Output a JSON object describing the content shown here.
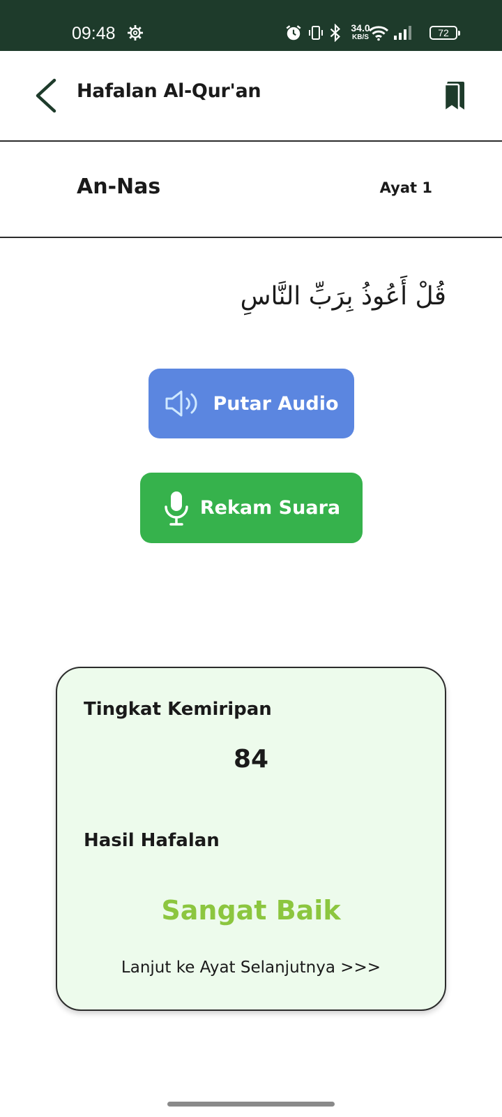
{
  "status_bar": {
    "time": "09:48",
    "net_speed_value": "34.0",
    "net_speed_unit": "KB/S",
    "battery_level": "72"
  },
  "app_bar": {
    "title": "Hafalan Al-Qur'an"
  },
  "surah": {
    "name": "An-Nas",
    "ayat_label": "Ayat 1"
  },
  "verse": {
    "arabic_text": "قُلْ أَعُوذُ بِرَبِّ النَّاسِ"
  },
  "actions": {
    "play_audio_label": "Putar Audio",
    "record_voice_label": "Rekam Suara"
  },
  "result": {
    "similarity_label": "Tingkat Kemiripan",
    "similarity_score": "84",
    "result_label": "Hasil Hafalan",
    "grade": "Sangat Baik",
    "next_link": "Lanjut ke Ayat Selanjutnya >>>"
  },
  "colors": {
    "status_bar_bg": "#1e3b2b",
    "audio_button": "#5b86e0",
    "record_button": "#36b24c",
    "card_bg": "#edfbec",
    "grade_text": "#8cc63f",
    "icon_dark_green": "#1e3b2b"
  }
}
